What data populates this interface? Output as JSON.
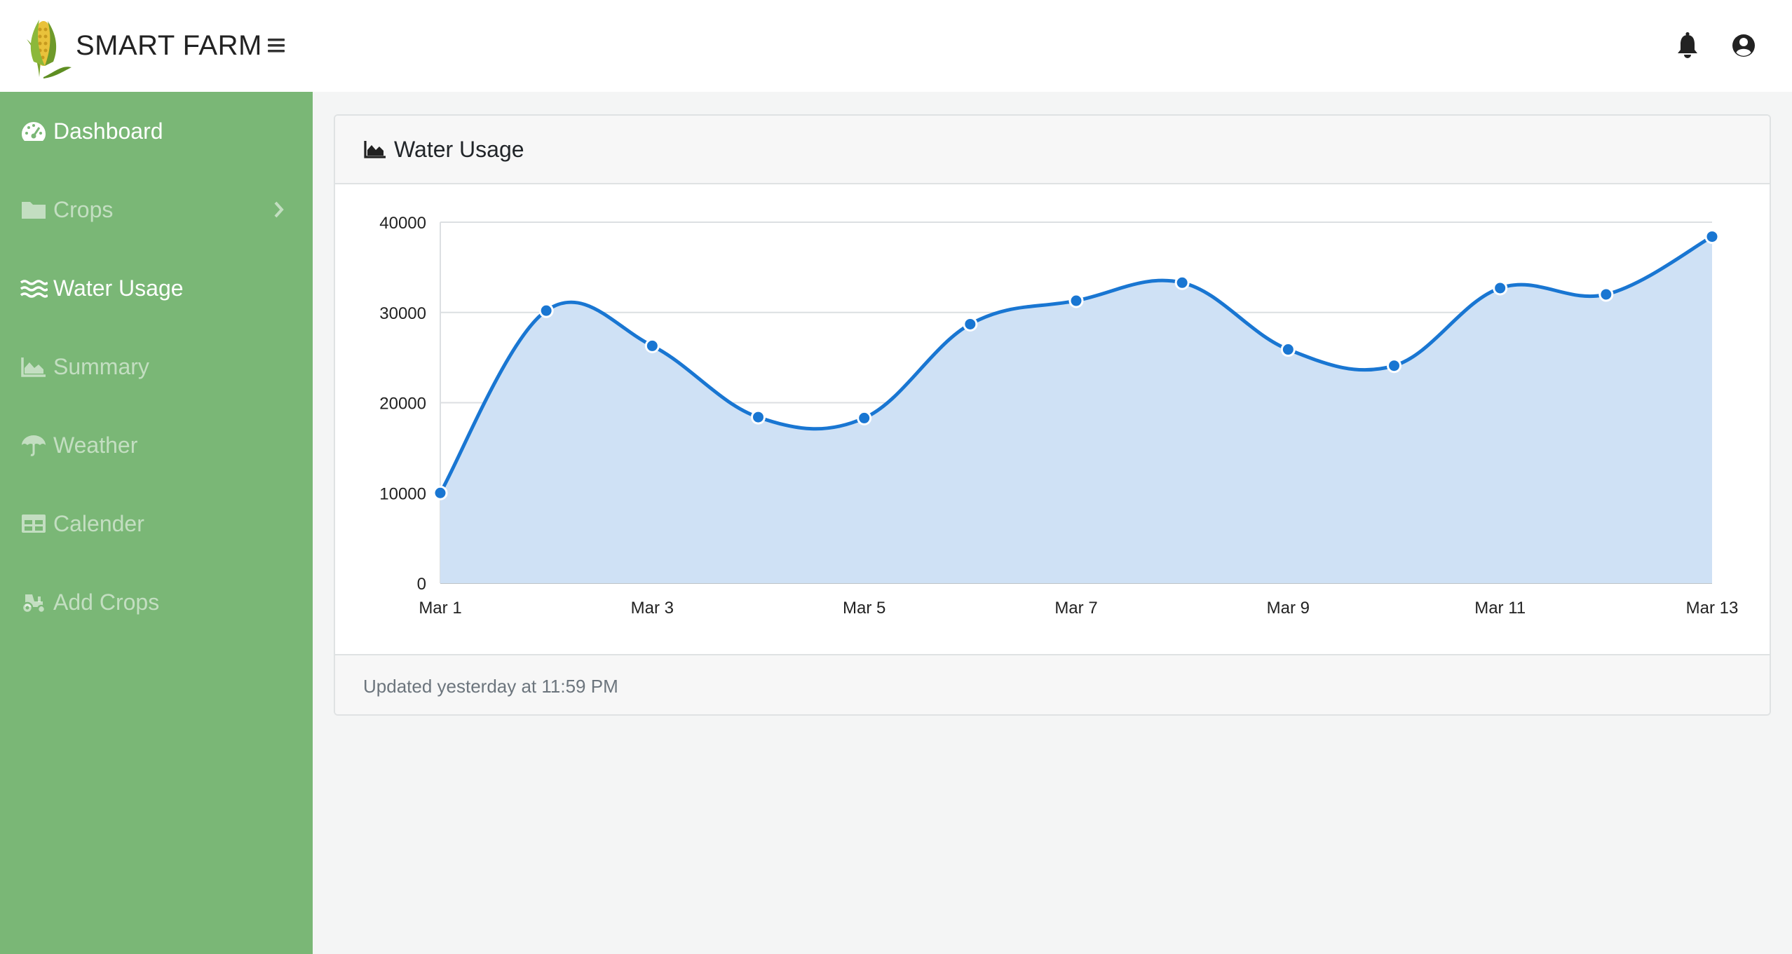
{
  "brand": {
    "title": "SMART FARM",
    "logo_icon": "corn-logo-icon"
  },
  "topbar": {
    "icons": [
      "menu-icon",
      "bell-icon",
      "user-circle-icon"
    ]
  },
  "sidebar": {
    "background": "#7ab776",
    "items": [
      {
        "label": "Dashboard",
        "icon": "tachometer-icon",
        "active": true
      },
      {
        "label": "Crops",
        "icon": "folder-icon",
        "active": false,
        "has_submenu": true
      },
      {
        "label": "Water Usage",
        "icon": "water-icon",
        "active": true
      },
      {
        "label": "Summary",
        "icon": "area-chart-icon",
        "active": false
      },
      {
        "label": "Weather",
        "icon": "umbrella-icon",
        "active": false
      },
      {
        "label": "Calender",
        "icon": "table-icon",
        "active": false
      },
      {
        "label": "Add Crops",
        "icon": "tractor-icon",
        "active": false
      }
    ]
  },
  "card": {
    "title": "Water Usage",
    "title_icon": "area-chart-icon",
    "footer": "Updated yesterday at 11:59 PM"
  },
  "chart_data": {
    "type": "area",
    "x": [
      "Mar 1",
      "Mar 2",
      "Mar 3",
      "Mar 4",
      "Mar 5",
      "Mar 6",
      "Mar 7",
      "Mar 8",
      "Mar 9",
      "Mar 10",
      "Mar 11",
      "Mar 12",
      "Mar 13"
    ],
    "x_tick_labels": [
      "Mar 1",
      "Mar 3",
      "Mar 5",
      "Mar 7",
      "Mar 9",
      "Mar 11",
      "Mar 13"
    ],
    "series": [
      {
        "values": [
          10000,
          30200,
          26300,
          18400,
          18300,
          28700,
          31300,
          33300,
          25900,
          24100,
          32700,
          32000,
          38400
        ],
        "color": "#1976d2",
        "fill": "#cfe1f5"
      }
    ],
    "ylim": [
      0,
      40000
    ],
    "y_ticks": [
      0,
      10000,
      20000,
      30000,
      40000
    ],
    "grid": true,
    "legend": "none"
  }
}
